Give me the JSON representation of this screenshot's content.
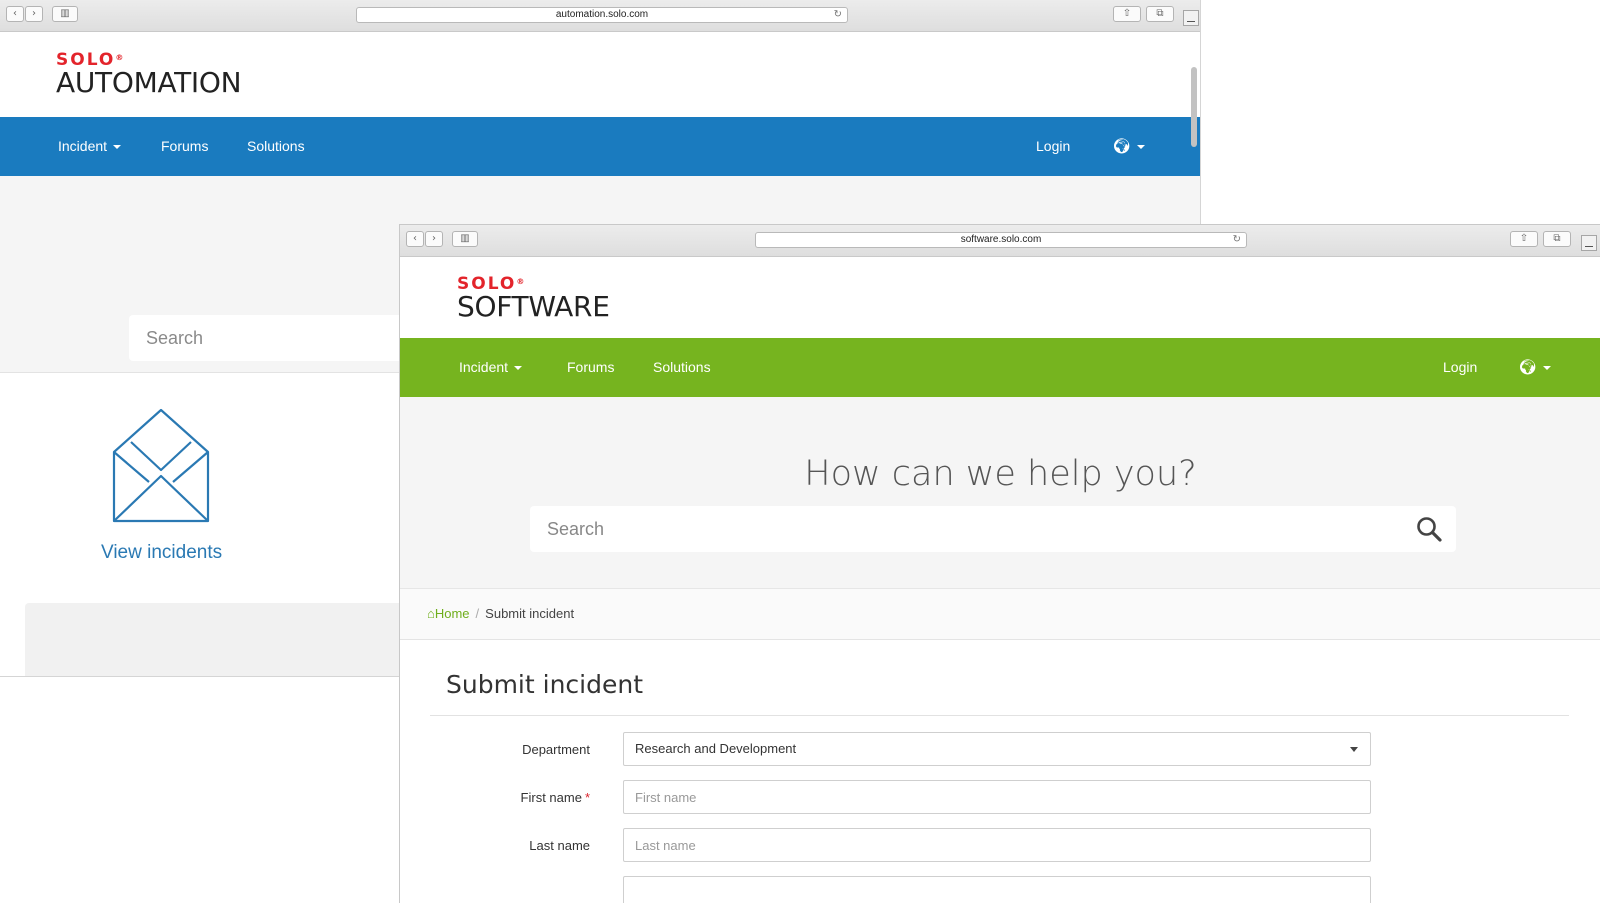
{
  "back_window": {
    "url": "automation.solo.com",
    "brand": {
      "solo": "SOLO",
      "reg": "®",
      "name": "AUTOMATION"
    },
    "nav": {
      "incident": "Incident",
      "forums": "Forums",
      "solutions": "Solutions",
      "login": "Login",
      "globe_icon": "globe-icon"
    },
    "search_placeholder": "Search",
    "tile_label": "View incidents",
    "accent_color": "#1a7bbf"
  },
  "front_window": {
    "url": "software.solo.com",
    "brand": {
      "solo": "SOLO",
      "reg": "®",
      "name": "SOFTWARE"
    },
    "nav": {
      "incident": "Incident",
      "forums": "Forums",
      "solutions": "Solutions",
      "login": "Login",
      "globe_icon": "globe-icon"
    },
    "hero_title": "How can we help you?",
    "search_placeholder": "Search",
    "breadcrumb": {
      "home": "Home",
      "separator": "/",
      "current": "Submit incident"
    },
    "page_title": "Submit incident",
    "form": {
      "department": {
        "label": "Department",
        "value": "Research and Development"
      },
      "first_name": {
        "label": "First name",
        "required_marker": "*",
        "placeholder": "First name"
      },
      "last_name": {
        "label": "Last name",
        "placeholder": "Last name"
      }
    },
    "accent_color": "#76b41f"
  }
}
